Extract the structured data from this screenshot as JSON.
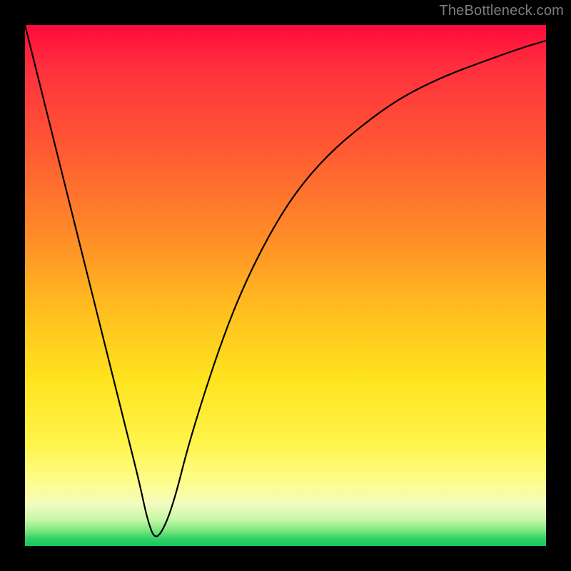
{
  "watermark": "TheBottleneck.com",
  "chart_data": {
    "type": "line",
    "title": "",
    "xlabel": "",
    "ylabel": "",
    "xlim": [
      0,
      100
    ],
    "ylim": [
      0,
      100
    ],
    "grid": false,
    "legend": false,
    "series": [
      {
        "name": "curve",
        "x": [
          0,
          5,
          10,
          15,
          18,
          20,
          22,
          23.5,
          25,
          27,
          29,
          31,
          34,
          38,
          42,
          47,
          52,
          58,
          65,
          72,
          80,
          88,
          95,
          100
        ],
        "values": [
          100,
          80,
          60,
          40,
          28,
          20,
          12,
          5,
          1,
          4,
          10,
          18,
          28,
          40,
          50,
          60,
          68,
          75,
          81,
          86,
          90,
          93,
          95.5,
          97
        ]
      }
    ],
    "trough": {
      "x": 24.5,
      "y": 0.5
    },
    "colors": {
      "curve": "#000000",
      "marker": "#d86a6c",
      "background_top": "#ff0a3c",
      "background_bottom": "#16c55e"
    }
  }
}
